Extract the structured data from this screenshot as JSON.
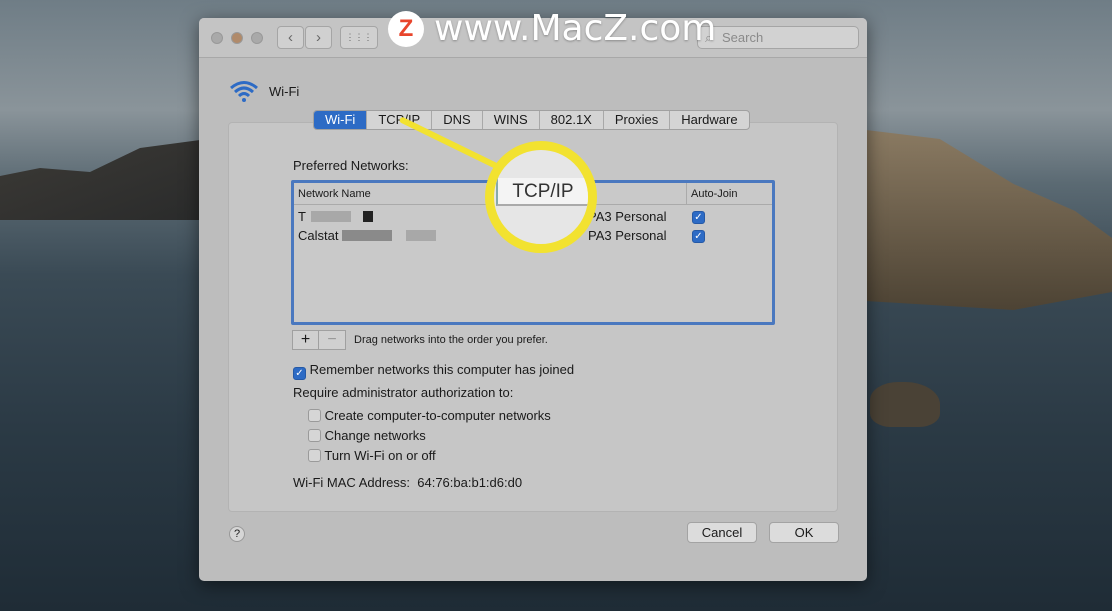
{
  "watermark": {
    "logo": "Z",
    "text": "www.MacZ.com"
  },
  "toolbar": {
    "back": "‹",
    "forward": "›",
    "grid": "⋮⋮⋮",
    "search_placeholder": "Search"
  },
  "header": {
    "title": "Wi-Fi"
  },
  "tabs": [
    {
      "label": "Wi-Fi",
      "selected": true
    },
    {
      "label": "TCP/IP"
    },
    {
      "label": "DNS"
    },
    {
      "label": "WINS"
    },
    {
      "label": "802.1X"
    },
    {
      "label": "Proxies"
    },
    {
      "label": "Hardware"
    }
  ],
  "preferred": {
    "label": "Preferred Networks:",
    "col_name": "Network Name",
    "col_autojoin": "Auto-Join",
    "rows": [
      {
        "name": "T",
        "security": "PA3 Personal",
        "auto_join": true
      },
      {
        "name": "Calstat",
        "security": "PA3 Personal",
        "auto_join": true
      }
    ]
  },
  "list_controls": {
    "add": "+",
    "remove": "−",
    "hint": "Drag networks into the order you prefer."
  },
  "options": {
    "remember": {
      "label": "Remember networks this computer has joined",
      "checked": true
    },
    "require_label": "Require administrator authorization to:",
    "admin": [
      {
        "label": "Create computer-to-computer networks",
        "checked": false
      },
      {
        "label": "Change networks",
        "checked": false
      },
      {
        "label": "Turn Wi-Fi on or off",
        "checked": false
      }
    ]
  },
  "mac": {
    "label": "Wi-Fi MAC Address:",
    "value": "64:76:ba:b1:d6:d0"
  },
  "buttons": {
    "help": "?",
    "cancel": "Cancel",
    "ok": "OK"
  },
  "callout": {
    "text": "TCP/IP",
    "color": "#f2e230"
  },
  "colors": {
    "accent": "#2d6bc5"
  }
}
